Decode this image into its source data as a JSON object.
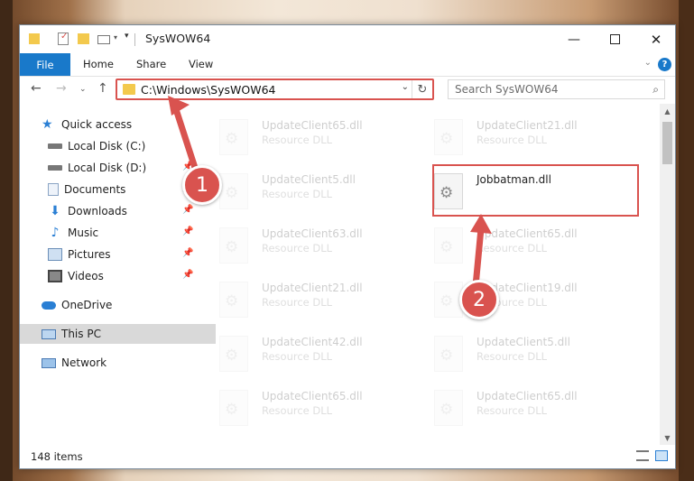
{
  "window": {
    "title": "SysWOW64"
  },
  "ribbon": {
    "tabs": [
      "File",
      "Home",
      "Share",
      "View"
    ],
    "help": "?"
  },
  "nav": {
    "address": "C:\\Windows\\SysWOW64",
    "search_placeholder": "Search SysWOW64"
  },
  "sidebar": {
    "items": [
      {
        "label": "Quick access",
        "icon": "star-icon"
      },
      {
        "label": "Local Disk (C:)",
        "icon": "drive-icon"
      },
      {
        "label": "Local Disk (D:)",
        "icon": "drive-icon"
      },
      {
        "label": "Documents",
        "icon": "documents-icon"
      },
      {
        "label": "Downloads",
        "icon": "download-icon"
      },
      {
        "label": "Music",
        "icon": "music-icon"
      },
      {
        "label": "Pictures",
        "icon": "pictures-icon"
      },
      {
        "label": "Videos",
        "icon": "videos-icon"
      },
      {
        "label": "OneDrive",
        "icon": "cloud-icon"
      },
      {
        "label": "This PC",
        "icon": "computer-icon"
      },
      {
        "label": "Network",
        "icon": "network-icon"
      }
    ]
  },
  "files": [
    {
      "name": "UpdateClient65.dll",
      "type": "Resource DLL"
    },
    {
      "name": "UpdateClient21.dll",
      "type": "Resource DLL"
    },
    {
      "name": "UpdateClient5.dll",
      "type": "Resource DLL"
    },
    {
      "name": "Jobbatman.dll",
      "type": ""
    },
    {
      "name": "UpdateClient63.dll",
      "type": "Resource DLL"
    },
    {
      "name": "UpdateClient65.dll",
      "type": "Resource DLL"
    },
    {
      "name": "UpdateClient21.dll",
      "type": "Resource DLL"
    },
    {
      "name": "UpdateClient19.dll",
      "type": "Resource DLL"
    },
    {
      "name": "UpdateClient42.dll",
      "type": "Resource DLL"
    },
    {
      "name": "UpdateClient5.dll",
      "type": "Resource DLL"
    },
    {
      "name": "UpdateClient65.dll",
      "type": "Resource DLL"
    },
    {
      "name": "UpdateClient65.dll",
      "type": "Resource DLL"
    }
  ],
  "status": {
    "item_count": "148 items"
  },
  "annotations": {
    "step1": "1",
    "step2": "2"
  },
  "colors": {
    "accent": "#1979ca",
    "highlight": "#d9534f"
  }
}
